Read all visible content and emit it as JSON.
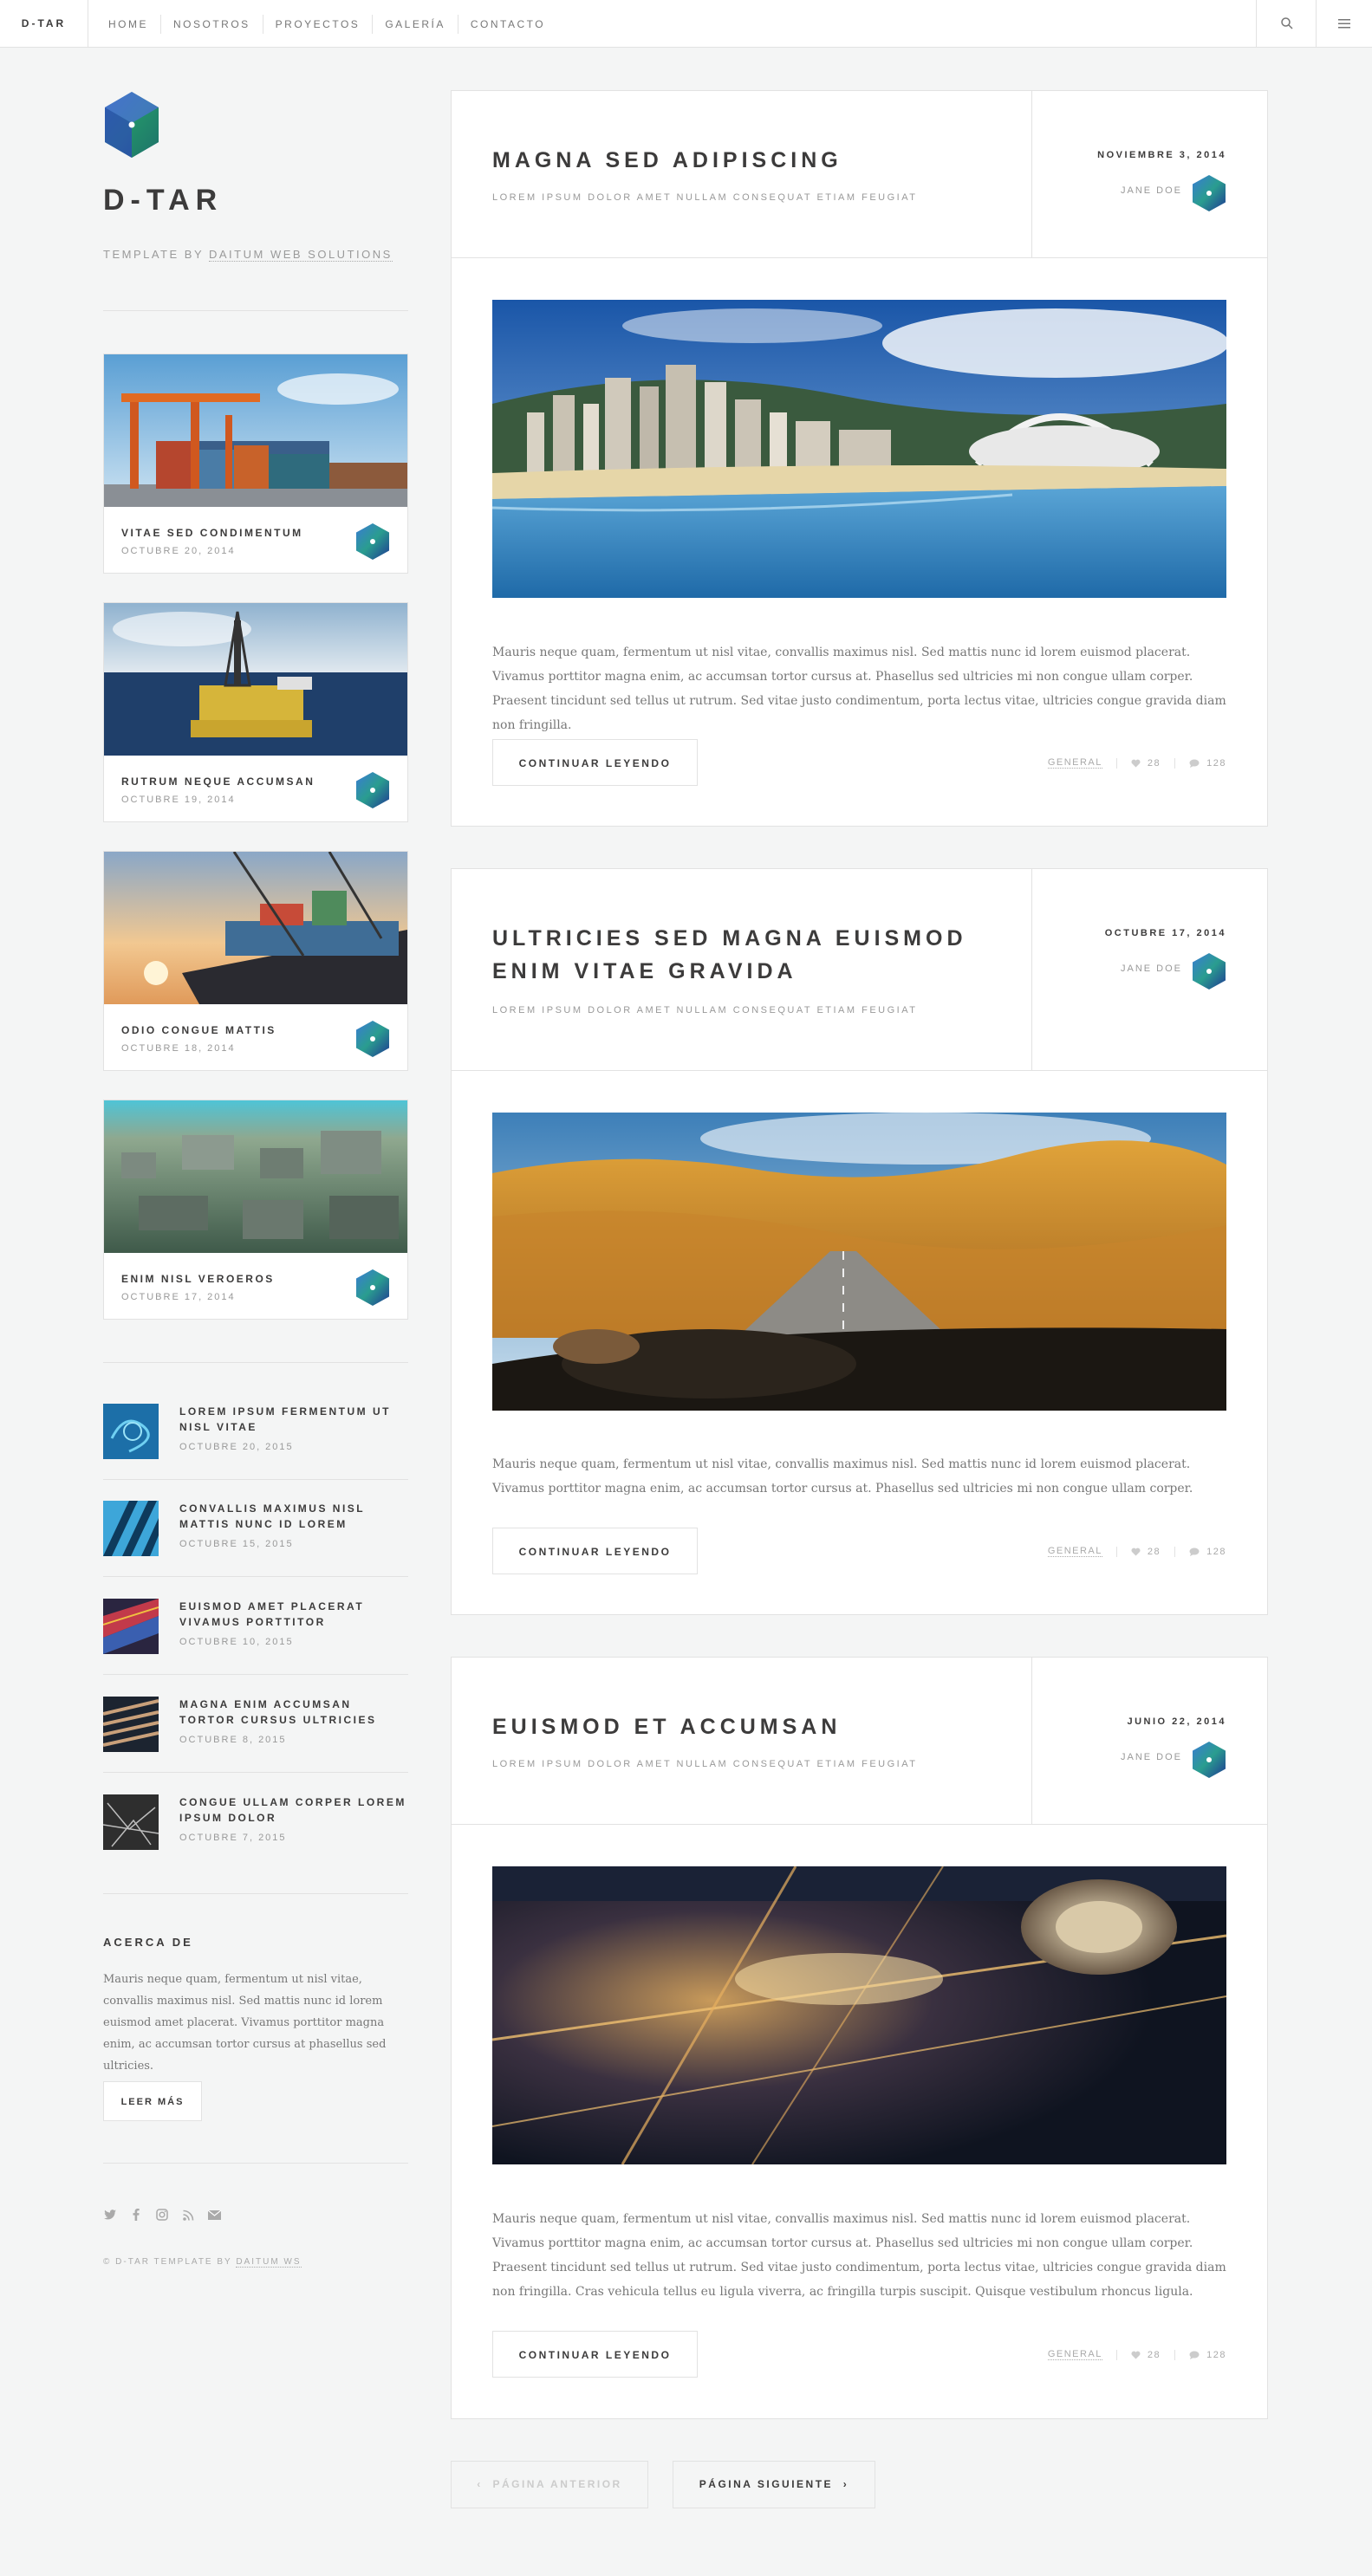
{
  "topbar": {
    "brand": "D-TAR",
    "nav": [
      "HOME",
      "NOSOTROS",
      "PROYECTOS",
      "GALERÍA",
      "CONTACTO"
    ]
  },
  "sidebar": {
    "title": "D-TAR",
    "subtitle_prefix": "TEMPLATE BY ",
    "subtitle_link": "DAITUM WEB SOLUTIONS",
    "mini_posts": [
      {
        "title": "VITAE SED CONDIMENTUM",
        "date": "OCTUBRE 20, 2014"
      },
      {
        "title": "RUTRUM NEQUE ACCUMSAN",
        "date": "OCTUBRE 19, 2014"
      },
      {
        "title": "ODIO CONGUE MATTIS",
        "date": "OCTUBRE 18, 2014"
      },
      {
        "title": "ENIM NISL VEROEROS",
        "date": "OCTUBRE 17, 2014"
      }
    ],
    "list_posts": [
      {
        "title": "LOREM IPSUM FERMENTUM UT NISL VITAE",
        "date": "OCTUBRE 20, 2015"
      },
      {
        "title": "CONVALLIS MAXIMUS NISL MATTIS NUNC ID LOREM",
        "date": "OCTUBRE 15, 2015"
      },
      {
        "title": "EUISMOD AMET PLACERAT VIVAMUS PORTTITOR",
        "date": "OCTUBRE 10, 2015"
      },
      {
        "title": "MAGNA ENIM ACCUMSAN TORTOR CURSUS ULTRICIES",
        "date": "OCTUBRE 8, 2015"
      },
      {
        "title": "CONGUE ULLAM CORPER LOREM IPSUM DOLOR",
        "date": "OCTUBRE 7, 2015"
      }
    ],
    "about": {
      "heading": "ACERCA DE",
      "text": "Mauris neque quam, fermentum ut nisl vitae, convallis maximus nisl. Sed mattis nunc id lorem euismod amet placerat. Vivamus porttitor magna enim, ac accumsan tortor cursus at phasellus sed ultricies.",
      "button": "LEER MÁS"
    },
    "footer_prefix": "© D-TAR TEMPLATE BY ",
    "footer_link": "DAITUM WS"
  },
  "posts": [
    {
      "title": "MAGNA SED ADIPISCING",
      "subtitle": "LOREM IPSUM DOLOR AMET NULLAM CONSEQUAT ETIAM FEUGIAT",
      "date": "NOVIEMBRE 3, 2014",
      "author": "JANE DOE",
      "text": "Mauris neque quam, fermentum ut nisl vitae, convallis maximus nisl. Sed mattis nunc id lorem euismod placerat. Vivamus porttitor magna enim, ac accumsan tortor cursus at. Phasellus sed ultricies mi non congue ullam corper. Praesent tincidunt sed tellus ut rutrum. Sed vitae justo condimentum, porta lectus vitae, ultricies congue gravida diam non fringilla.",
      "button": "CONTINUAR LEYENDO",
      "category": "GENERAL",
      "likes": "28",
      "comments": "128"
    },
    {
      "title": "ULTRICIES SED MAGNA EUISMOD ENIM VITAE GRAVIDA",
      "subtitle": "LOREM IPSUM DOLOR AMET NULLAM CONSEQUAT ETIAM FEUGIAT",
      "date": "OCTUBRE 17, 2014",
      "author": "JANE DOE",
      "text": "Mauris neque quam, fermentum ut nisl vitae, convallis maximus nisl. Sed mattis nunc id lorem euismod placerat. Vivamus porttitor magna enim, ac accumsan tortor cursus at. Phasellus sed ultricies mi non congue ullam corper.",
      "button": "CONTINUAR LEYENDO",
      "category": "GENERAL",
      "likes": "28",
      "comments": "128"
    },
    {
      "title": "EUISMOD ET ACCUMSAN",
      "subtitle": "LOREM IPSUM DOLOR AMET NULLAM CONSEQUAT ETIAM FEUGIAT",
      "date": "JUNIO 22, 2014",
      "author": "JANE DOE",
      "text": "Mauris neque quam, fermentum ut nisl vitae, convallis maximus nisl. Sed mattis nunc id lorem euismod placerat. Vivamus porttitor magna enim, ac accumsan tortor cursus at. Phasellus sed ultricies mi non congue ullam corper. Praesent tincidunt sed tellus ut rutrum. Sed vitae justo condimentum, porta lectus vitae, ultricies congue gravida diam non fringilla. Cras vehicula tellus eu ligula viverra, ac fringilla turpis suscipit. Quisque vestibulum rhoncus ligula.",
      "button": "CONTINUAR LEYENDO",
      "category": "GENERAL",
      "likes": "28",
      "comments": "128"
    }
  ],
  "pagination": {
    "prev": "PÁGINA ANTERIOR",
    "next": "PÁGINA SIGUIENTE"
  },
  "colors": {
    "background": "#f4f5f5",
    "text": "#3c3b3b",
    "muted": "#999999",
    "border": "#e2e2e2"
  },
  "icons": [
    "search-icon",
    "menu-icon",
    "twitter-icon",
    "facebook-icon",
    "instagram-icon",
    "rss-icon",
    "email-icon",
    "heart-icon",
    "comment-icon"
  ]
}
